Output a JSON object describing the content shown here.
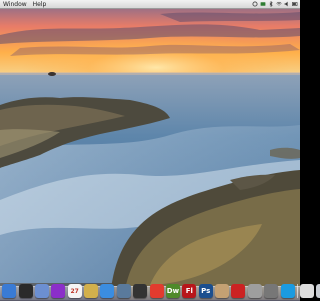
{
  "menubar": {
    "items": [
      "Window",
      "Help"
    ]
  },
  "status_icons": [
    "sync-icon",
    "timemachine-icon",
    "bluetooth-icon",
    "wifi-icon",
    "volume-icon",
    "battery-icon"
  ],
  "dock": {
    "apps": [
      {
        "name": "finder-icon",
        "color": "#3a7bd5",
        "label": ""
      },
      {
        "name": "dashboard-icon",
        "color": "#2a2a2a",
        "label": ""
      },
      {
        "name": "mail-icon",
        "color": "#6c8fd1",
        "label": ""
      },
      {
        "name": "itunes-icon",
        "color": "#8b2fc9",
        "label": ""
      },
      {
        "name": "calendar-icon",
        "color": "#f5f5f5",
        "label": "27"
      },
      {
        "name": "iphoto-icon",
        "color": "#d2b04c",
        "label": ""
      },
      {
        "name": "safari-icon",
        "color": "#3b8de0",
        "label": ""
      },
      {
        "name": "preview-icon",
        "color": "#5a7a9c",
        "label": ""
      },
      {
        "name": "camera-icon",
        "color": "#333333",
        "label": ""
      },
      {
        "name": "app-store-icon",
        "color": "#e33b2e",
        "label": ""
      },
      {
        "name": "dreamweaver-icon",
        "color": "#4f8a2a",
        "label": "Dw"
      },
      {
        "name": "flash-icon",
        "color": "#b8161b",
        "label": "Fl"
      },
      {
        "name": "photoshop-icon",
        "color": "#1b4f8f",
        "label": "Ps"
      },
      {
        "name": "folder-icon",
        "color": "#c4a173",
        "label": ""
      },
      {
        "name": "itunes-store-icon",
        "color": "#cc2222",
        "label": ""
      },
      {
        "name": "acrobat-icon",
        "color": "#9e9e9e",
        "label": ""
      },
      {
        "name": "system-preferences-icon",
        "color": "#777777",
        "label": ""
      },
      {
        "name": "skype-icon",
        "color": "#1b9be0",
        "label": ""
      }
    ],
    "stack_items": [
      {
        "name": "documents-stack-icon",
        "color": "#dcdcdc"
      },
      {
        "name": "trash-icon",
        "color": "#c8ccd2"
      }
    ]
  },
  "colors": {
    "menubar_bg": "#e6e6e6",
    "sky_top": "#7c6a90",
    "sky_glow": "#ffb04a",
    "sea": "#5c83a8",
    "rock": "#5a5446"
  }
}
